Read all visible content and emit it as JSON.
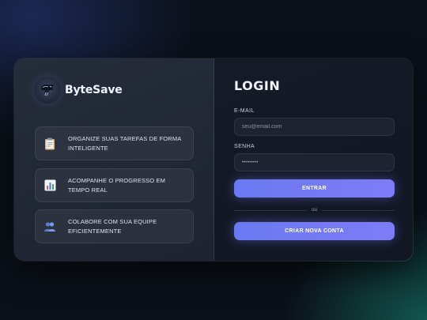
{
  "brand": {
    "name": "ByteSave",
    "logo_icon": "dragon-icon"
  },
  "features": [
    {
      "icon": "clipboard-icon",
      "text": "ORGANIZE SUAS TAREFAS DE FORMA INTELIGENTE"
    },
    {
      "icon": "bar-chart-icon",
      "text": "ACOMPANHE O PROGRESSO EM TEMPO REAL"
    },
    {
      "icon": "people-icon",
      "text": "COLABORE COM SUA EQUIPE EFICIENTEMENTE"
    }
  ],
  "login": {
    "title": "LOGIN",
    "email_label": "E-MAIL",
    "email_placeholder": "seu@email.com",
    "password_label": "SENHA",
    "password_value": "••••••••",
    "submit_label": "ENTRAR",
    "divider_text": "ou",
    "create_account_label": "CRIAR NOVA CONTA"
  },
  "colors": {
    "accent": "#7079f4",
    "background": "#0b1019",
    "panel_left": "#222937",
    "panel_right": "#141925"
  }
}
